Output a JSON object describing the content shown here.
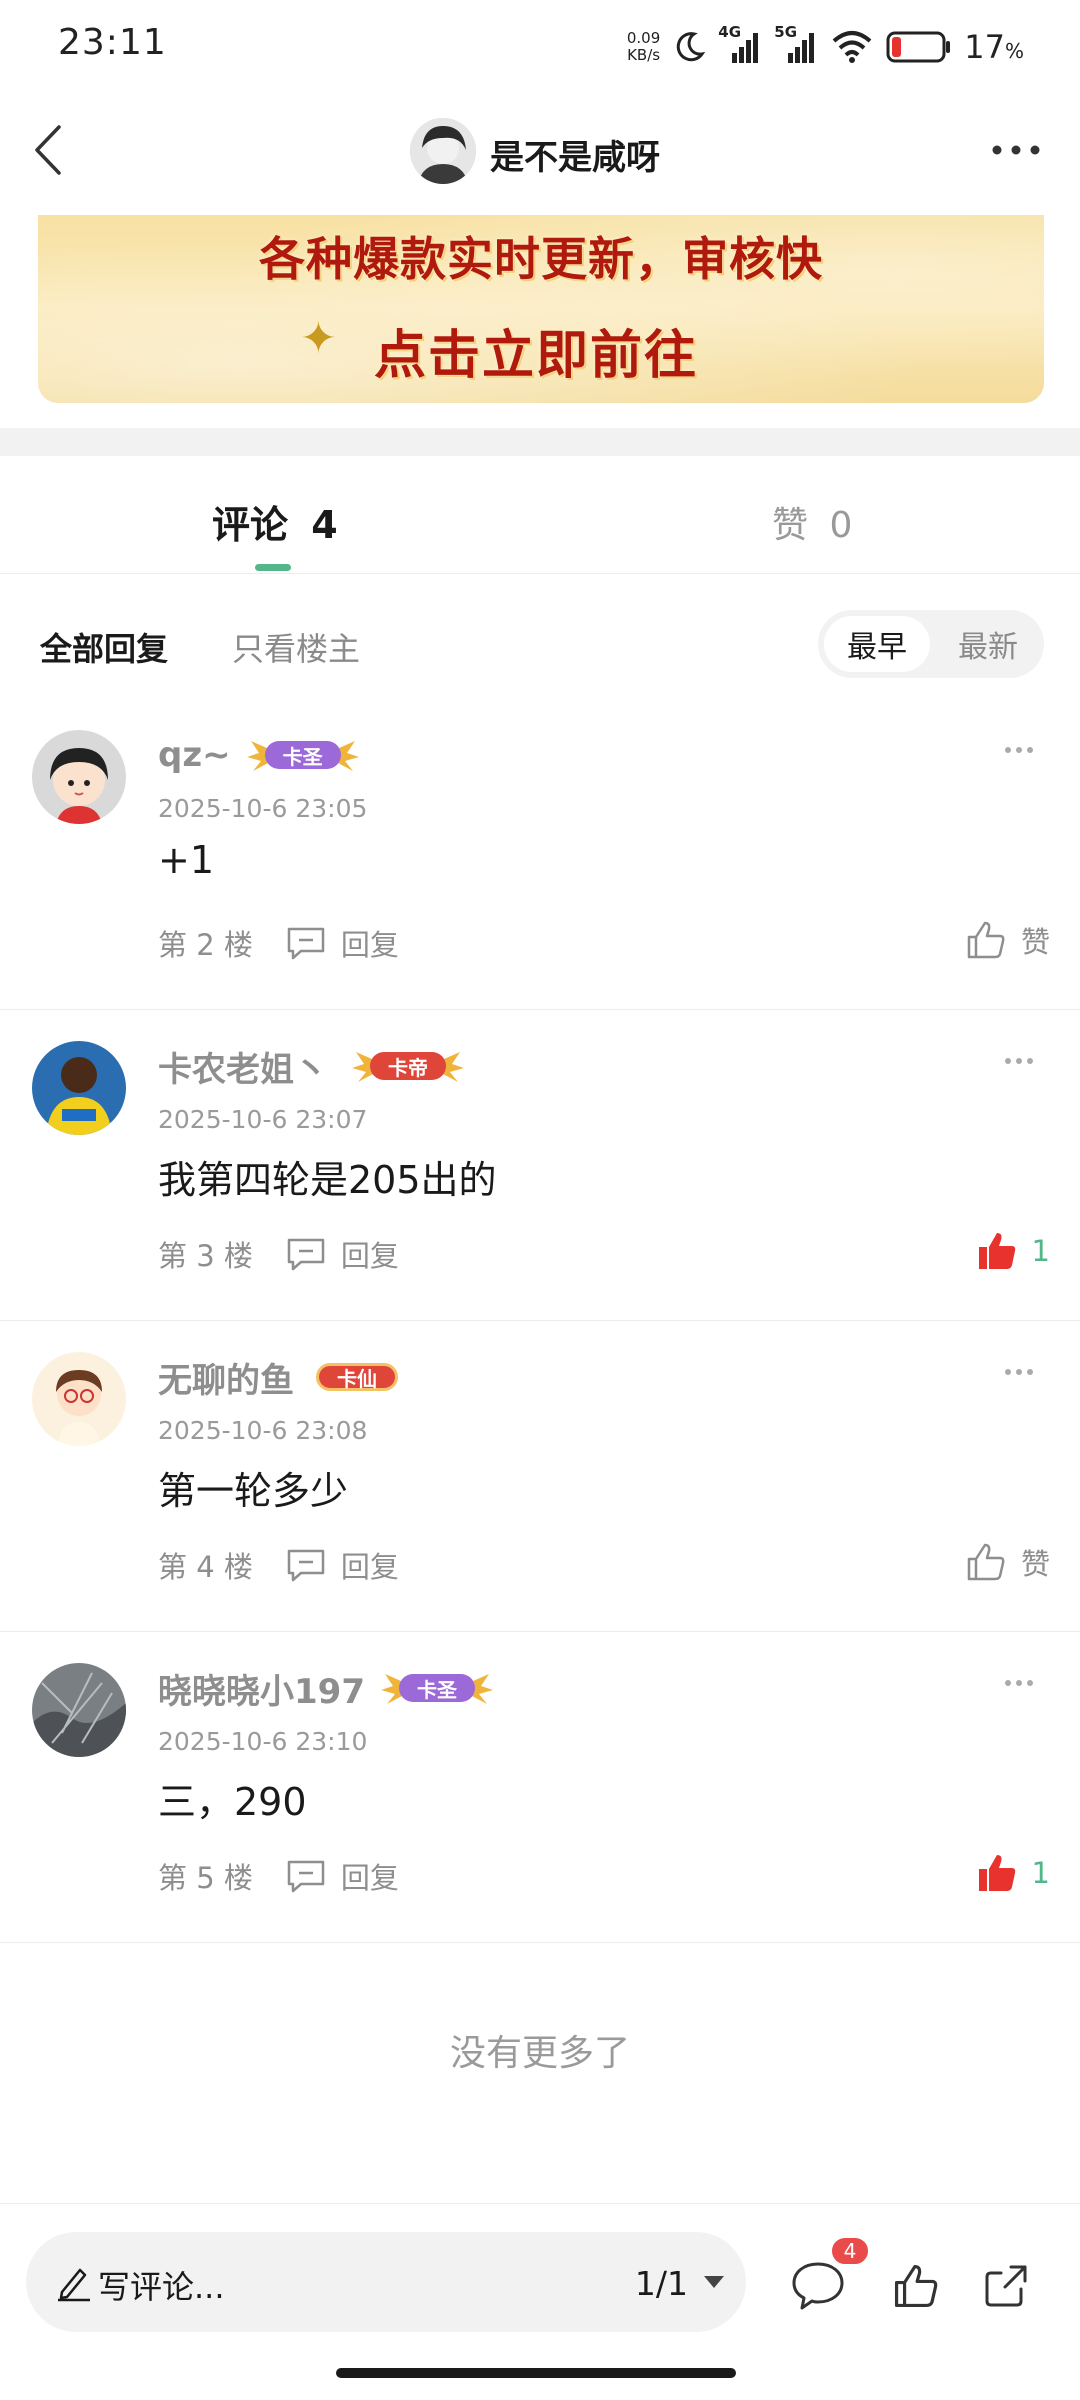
{
  "status_bar": {
    "time": "23:11",
    "speed_value": "0.09",
    "speed_unit": "KB/s",
    "network_1": "4G",
    "network_2": "5G",
    "battery_pct": "17",
    "battery_unit": "%",
    "battery_level": 0.17
  },
  "nav": {
    "title": "是不是咸呀"
  },
  "banner": {
    "line1": "各种爆款实时更新，审核快",
    "line2": "点击立即前往"
  },
  "tabs": {
    "comments_label": "评论",
    "comments_count": "4",
    "likes_label": "赞",
    "likes_count": "0"
  },
  "filters": {
    "all_replies": "全部回复",
    "op_only": "只看楼主",
    "sort_earliest": "最早",
    "sort_latest": "最新"
  },
  "comments": [
    {
      "name": "qz~",
      "badge": "卡圣",
      "time": "2025-10-6 23:05",
      "text": "+1",
      "floor": "第 2 楼",
      "reply": "回复",
      "like_text": "赞",
      "liked": false
    },
    {
      "name": "卡农老姐丶",
      "badge": "卡帝",
      "time": "2025-10-6 23:07",
      "text": "我第四轮是205出的",
      "floor": "第 3 楼",
      "reply": "回复",
      "like_text": "1",
      "liked": true
    },
    {
      "name": "无聊的鱼",
      "badge": "卡仙",
      "time": "2025-10-6 23:08",
      "text": "第一轮多少",
      "floor": "第 4 楼",
      "reply": "回复",
      "like_text": "赞",
      "liked": false
    },
    {
      "name": "晓晓晓小197",
      "badge": "卡圣",
      "time": "2025-10-6 23:10",
      "text": "三，290",
      "floor": "第 5 楼",
      "reply": "回复",
      "like_text": "1",
      "liked": true
    }
  ],
  "end_text": "没有更多了",
  "bottom_bar": {
    "placeholder": "写评论...",
    "page": "1/1",
    "comment_badge": "4"
  },
  "colors": {
    "accent_green": "#53b789",
    "like_red": "#e8322e",
    "badge_red": "#e94b4b"
  }
}
